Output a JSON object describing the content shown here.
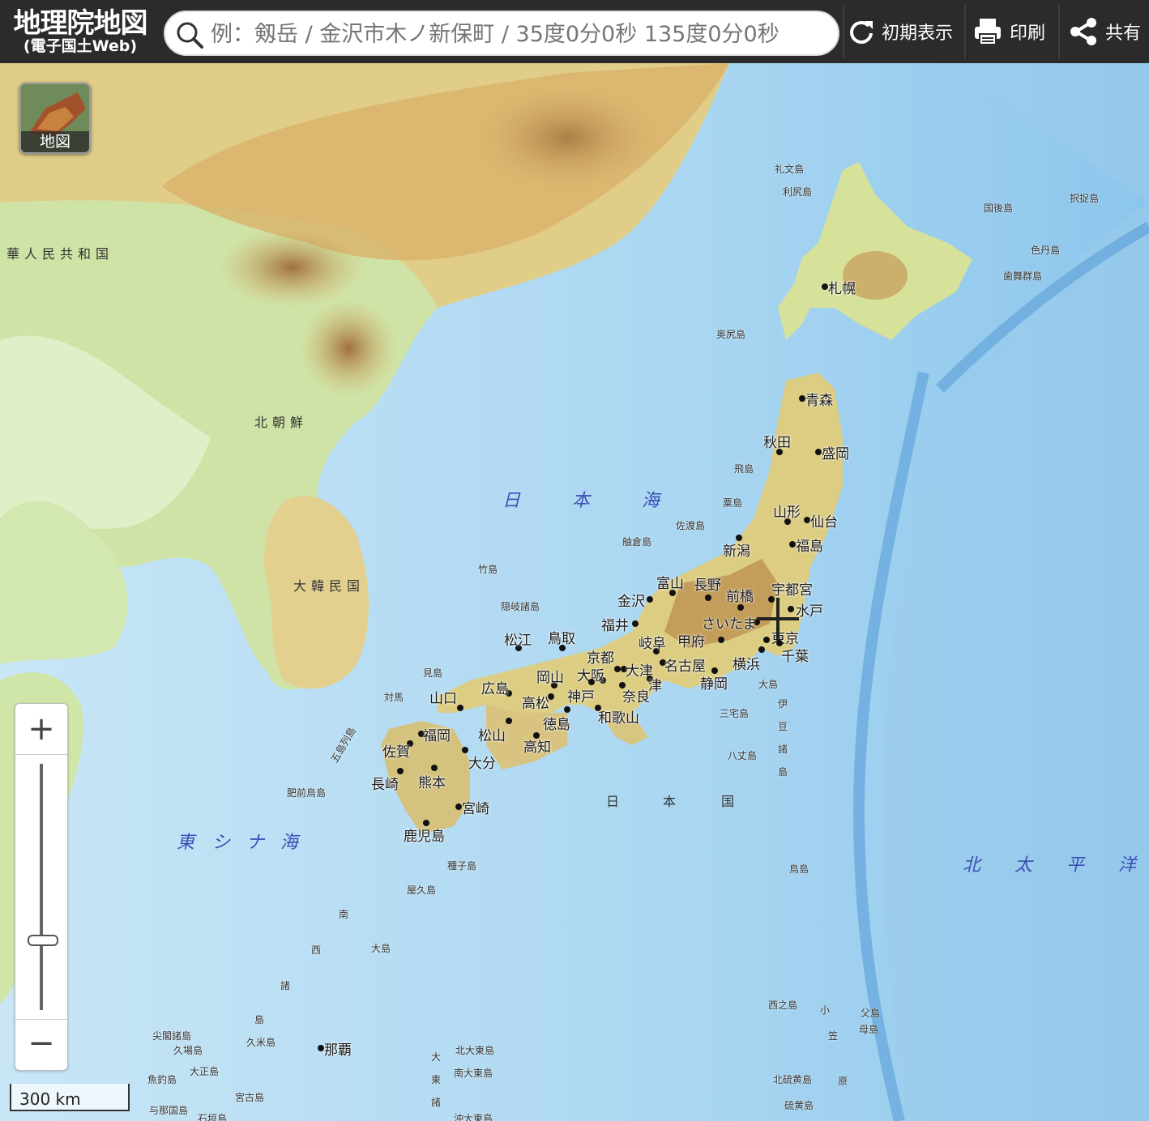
{
  "header": {
    "title": "地理院地図",
    "subtitle": "(電子国土Web)",
    "search_placeholder": "例：剱岳 / 金沢市木ノ新保町 / 35度0分0秒 135度0分0秒",
    "buttons": {
      "reset": "初期表示",
      "print": "印刷",
      "share": "共有"
    }
  },
  "layer_button": {
    "label": "地図"
  },
  "zoom": {
    "in": "+",
    "out": "−",
    "level_fraction": 0.29
  },
  "scale_bar": {
    "label": "300 km"
  },
  "seas": {
    "japan_sea": [
      "日",
      "本",
      "海"
    ],
    "east_china_sea": [
      "東",
      "シ",
      "ナ",
      "海"
    ],
    "north_pacific": [
      "北",
      "太",
      "平",
      "洋"
    ]
  },
  "countries": {
    "china": "華人民共和国",
    "north_korea": "北朝鮮",
    "south_korea": "大韓民国",
    "japan": [
      "日",
      "本",
      "国"
    ]
  },
  "cities": {
    "sapporo": "札幌",
    "aomori": "青森",
    "akita": "秋田",
    "morioka": "盛岡",
    "yamagata": "山形",
    "sendai": "仙台",
    "fukushima": "福島",
    "niigata": "新潟",
    "toyama": "富山",
    "nagano": "長野",
    "maebashi": "前橋",
    "utsunomiya": "宇都宮",
    "mito": "水戸",
    "kanazawa": "金沢",
    "fukui": "福井",
    "saitama": "さいたま",
    "tokyo": "東京",
    "chiba": "千葉",
    "yokohama": "横浜",
    "kofu": "甲府",
    "gifu": "岐阜",
    "nagoya": "名古屋",
    "shizuoka": "静岡",
    "otsu": "大津",
    "kyoto": "京都",
    "tsu": "津",
    "osaka": "大阪",
    "nara": "奈良",
    "kobe": "神戸",
    "wakayama": "和歌山",
    "tottori": "鳥取",
    "matsue": "松江",
    "okayama": "岡山",
    "hiroshima": "広島",
    "yamaguchi": "山口",
    "takamatsu": "高松",
    "tokushima": "徳島",
    "matsuyama": "松山",
    "kochi": "高知",
    "fukuoka": "福岡",
    "saga": "佐賀",
    "oita": "大分",
    "nagasaki": "長崎",
    "kumamoto": "熊本",
    "miyazaki": "宮崎",
    "kagoshima": "鹿児島",
    "naha": "那覇"
  },
  "islands": {
    "rebun": "礼文島",
    "rishiri": "利尻島",
    "kunashiri": "国後島",
    "etorofu": "択捉島",
    "shikotan": "色丹島",
    "habomai": "歯舞群島",
    "okushiri": "奥尻島",
    "tobishima": "飛島",
    "awashima": "粟島",
    "sado": "佐渡島",
    "hegura": "舳倉島",
    "takeshima": "竹島",
    "oki": "隠岐諸島",
    "mishima": "見島",
    "tsushima": "対馬",
    "goto": "五島列島",
    "hizen_torishima": "肥前鳥島",
    "oshima": "大島",
    "izu": [
      "伊",
      "豆",
      "諸",
      "島"
    ],
    "miyake": "三宅島",
    "hachijo": "八丈島",
    "torishima": "鳥島",
    "tanegashima": "種子島",
    "yakushima": "屋久島",
    "amami_oshima": "大島",
    "nishinoshima": "西之島",
    "chichijima": "父島",
    "hahajima": "母島",
    "kita_iwo": "北硫黄島",
    "iwo": "硫黄島",
    "senkaku": "尖閣諸島",
    "kuba": "久場島",
    "taisho": "大正島",
    "uotsuri": "魚釣島",
    "kume": "久米島",
    "miyako": "宮古島",
    "yonaguni": "与那国島",
    "ishigaki": "石垣島",
    "kita_daito": "北大東島",
    "minami_daito": "南大東島",
    "oki_daito": "沖大東島",
    "daito": [
      "大",
      "東",
      "諸"
    ],
    "ogasawara": [
      "小",
      "笠",
      "原"
    ],
    "nansei": [
      "南",
      "西",
      "諸",
      "島"
    ]
  }
}
